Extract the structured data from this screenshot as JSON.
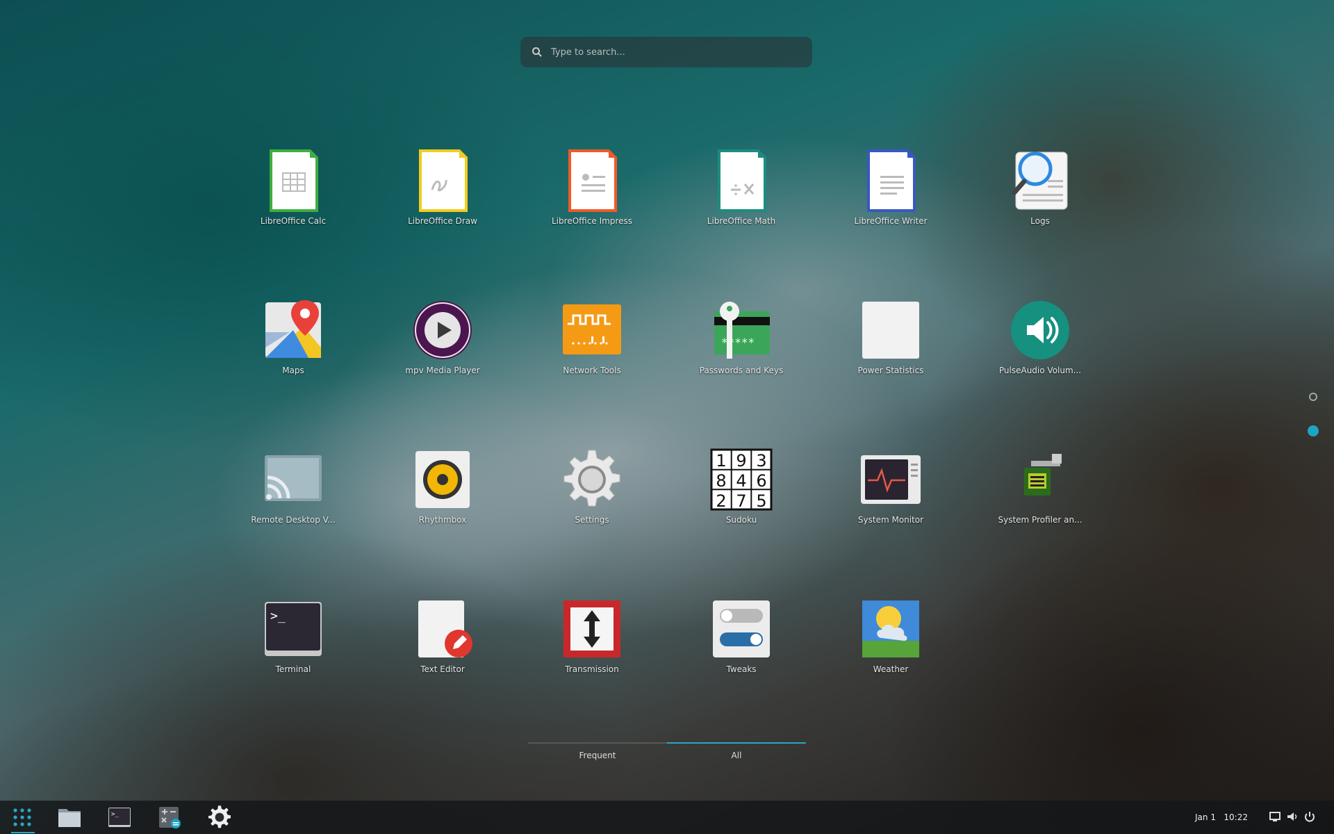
{
  "search": {
    "placeholder": "Type to search..."
  },
  "apps": [
    {
      "label": "LibreOffice Calc",
      "icon": "libreoffice-calc-icon"
    },
    {
      "label": "LibreOffice Draw",
      "icon": "libreoffice-draw-icon"
    },
    {
      "label": "LibreOffice Impress",
      "icon": "libreoffice-impress-icon"
    },
    {
      "label": "LibreOffice Math",
      "icon": "libreoffice-math-icon"
    },
    {
      "label": "LibreOffice Writer",
      "icon": "libreoffice-writer-icon"
    },
    {
      "label": "Logs",
      "icon": "logs-icon"
    },
    {
      "label": "Maps",
      "icon": "maps-icon"
    },
    {
      "label": "mpv Media Player",
      "icon": "mpv-icon"
    },
    {
      "label": "Network Tools",
      "icon": "network-tools-icon"
    },
    {
      "label": "Passwords and Keys",
      "icon": "passwords-keys-icon"
    },
    {
      "label": "Power Statistics",
      "icon": "power-statistics-icon"
    },
    {
      "label": "PulseAudio Volum...",
      "icon": "pulseaudio-icon"
    },
    {
      "label": "Remote Desktop V...",
      "icon": "remote-desktop-icon"
    },
    {
      "label": "Rhythmbox",
      "icon": "rhythmbox-icon"
    },
    {
      "label": "Settings",
      "icon": "settings-gear-icon"
    },
    {
      "label": "Sudoku",
      "icon": "sudoku-icon",
      "digits": [
        "1",
        "9",
        "3",
        "8",
        "4",
        "6",
        "2",
        "7",
        "5"
      ]
    },
    {
      "label": "System Monitor",
      "icon": "system-monitor-icon"
    },
    {
      "label": "System Profiler an...",
      "icon": "system-profiler-icon"
    },
    {
      "label": "Terminal",
      "icon": "terminal-icon"
    },
    {
      "label": "Text Editor",
      "icon": "text-editor-icon"
    },
    {
      "label": "Transmission",
      "icon": "transmission-icon"
    },
    {
      "label": "Tweaks",
      "icon": "tweaks-icon"
    },
    {
      "label": "Weather",
      "icon": "weather-icon"
    }
  ],
  "view_switcher": {
    "frequent": "Frequent",
    "all": "All",
    "active": "All"
  },
  "taskbar": {
    "apps": [
      "app-grid-icon",
      "files-icon",
      "terminal-icon",
      "calculator-icon",
      "settings-gear-icon"
    ],
    "clock": {
      "date": "Jan 1",
      "time": "10:22"
    },
    "tray": [
      "screen-icon",
      "volume-icon",
      "power-icon"
    ]
  },
  "colors": {
    "accent": "#2aa7c2",
    "dot_active": "#1da5c4"
  }
}
